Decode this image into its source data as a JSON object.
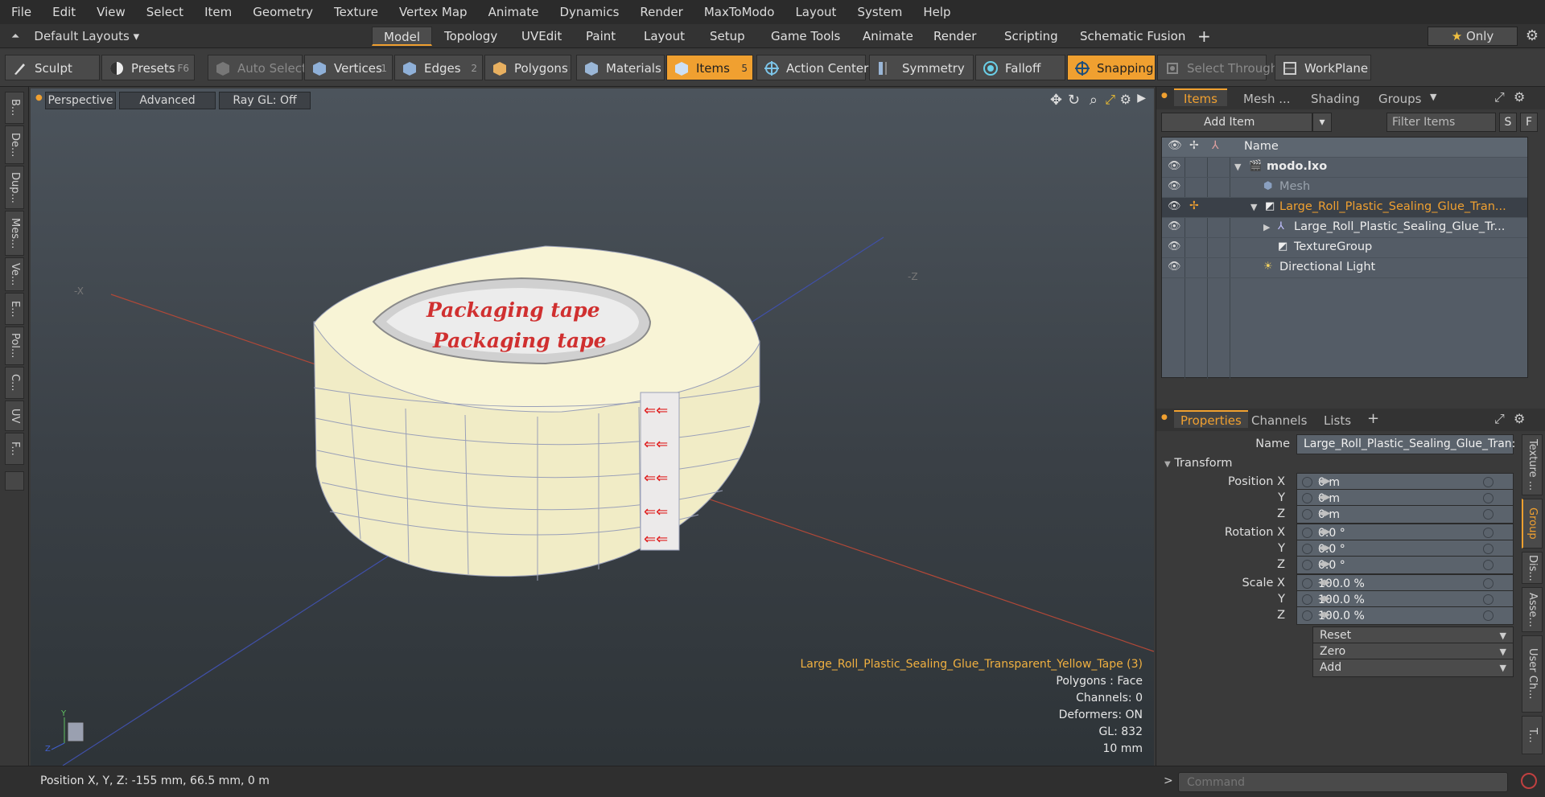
{
  "menu": [
    "File",
    "Edit",
    "View",
    "Select",
    "Item",
    "Geometry",
    "Texture",
    "Vertex Map",
    "Animate",
    "Dynamics",
    "Render",
    "MaxToModo",
    "Layout",
    "System",
    "Help"
  ],
  "layouts_label": "Default Layouts",
  "layout_tabs": [
    "Model",
    "Topology",
    "UVEdit",
    "Paint",
    "Layout",
    "Setup",
    "Game Tools",
    "Animate",
    "Render",
    "Scripting",
    "Schematic Fusion"
  ],
  "active_layout_tab": "Model",
  "only_label": "Only",
  "toolbar": {
    "sculpt": "Sculpt",
    "presets": "Presets",
    "presets_key": "F6",
    "auto_select": "Auto Select",
    "vertices": "Vertices",
    "vertices_key": "1",
    "edges": "Edges",
    "edges_key": "2",
    "polygons": "Polygons",
    "materials": "Materials",
    "items": "Items",
    "items_key": "5",
    "action_center": "Action Center",
    "symmetry": "Symmetry",
    "falloff": "Falloff",
    "snapping": "Snapping",
    "select_through": "Select Through",
    "workplane": "WorkPlane"
  },
  "left_tabs": [
    "B...",
    "De...",
    "Dup...",
    "Mes...",
    "Ve...",
    "E...",
    "Pol...",
    "C...",
    "UV",
    "F..."
  ],
  "viewport": {
    "perspective": "Perspective",
    "advanced": "Advanced",
    "raygl": "Ray GL: Off",
    "info_title": "Large_Roll_Plastic_Sealing_Glue_Transparent_Yellow_Tape (3)",
    "info_lines": [
      "Polygons : Face",
      "Channels: 0",
      "Deformers: ON",
      "GL: 832",
      "10 mm"
    ],
    "tape_text": "Packaging tape"
  },
  "status": "Position X, Y, Z:   -155 mm, 66.5 mm, 0 m",
  "panel_tabs": [
    "Items",
    "Mesh ...",
    "Shading",
    "Groups"
  ],
  "add_item": "Add Item",
  "filter_items": "Filter Items",
  "filter_s": "S",
  "filter_f": "F",
  "tree_header": "Name",
  "tree": [
    {
      "label": "modo.lxo",
      "bold": true
    },
    {
      "label": "Mesh",
      "dim": true
    },
    {
      "label": "Large_Roll_Plastic_Sealing_Glue_Tran...",
      "orange": true
    },
    {
      "label": "Large_Roll_Plastic_Sealing_Glue_Tr..."
    },
    {
      "label": "TextureGroup"
    },
    {
      "label": "Directional Light"
    }
  ],
  "prop_tabs": [
    "Properties",
    "Channels",
    "Lists"
  ],
  "name_label": "Name",
  "name_value": "Large_Roll_Plastic_Sealing_Glue_Tran:",
  "transform_label": "Transform",
  "props": [
    {
      "label": "Position X",
      "value": "0 m"
    },
    {
      "label": "Y",
      "value": "0 m"
    },
    {
      "label": "Z",
      "value": "0 m"
    },
    {
      "label": "Rotation X",
      "value": "0.0 °"
    },
    {
      "label": "Y",
      "value": "0.0 °"
    },
    {
      "label": "Z",
      "value": "0.0 °"
    },
    {
      "label": "Scale X",
      "value": "100.0 %"
    },
    {
      "label": "Y",
      "value": "100.0 %"
    },
    {
      "label": "Z",
      "value": "100.0 %"
    }
  ],
  "reset": "Reset",
  "zero": "Zero",
  "add": "Add",
  "right_tabs": [
    "Texture ...",
    "Group L...",
    "Dis...",
    "Asse...",
    "User Ch...",
    "T..."
  ],
  "command_placeholder": "Command",
  "colors": {
    "accent": "#f0a030",
    "selection_orange": "#f0b040"
  }
}
